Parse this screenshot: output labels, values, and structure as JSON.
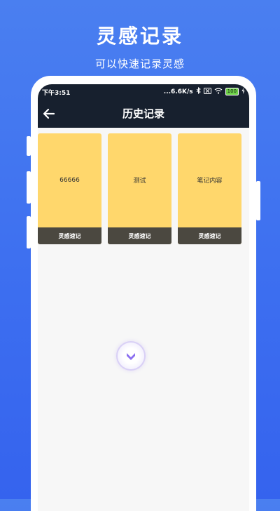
{
  "promo": {
    "title": "灵感记录",
    "subtitle": "可以快速记录灵感"
  },
  "statusbar": {
    "time": "下午3:51",
    "network_speed": "...6.6K/s",
    "battery": "100"
  },
  "appbar": {
    "title": "历史记录"
  },
  "cards": [
    {
      "content": "66666",
      "footer": "灵感速记"
    },
    {
      "content": "测试",
      "footer": "灵感速记"
    },
    {
      "content": "笔记内容",
      "footer": "灵感速记"
    }
  ],
  "colors": {
    "background": "#3d6ff0",
    "appbar": "#17202e",
    "card": "#ffd76c",
    "card_footer": "#4b4840",
    "fab_arrow": "#8b6ff0"
  },
  "icons": {
    "back": "arrow-left-icon",
    "bluetooth": "bluetooth-icon",
    "sim": "sim-off-icon",
    "wifi": "wifi-icon",
    "battery": "battery-icon",
    "charging": "charging-icon",
    "fab": "chevron-down-icon"
  }
}
